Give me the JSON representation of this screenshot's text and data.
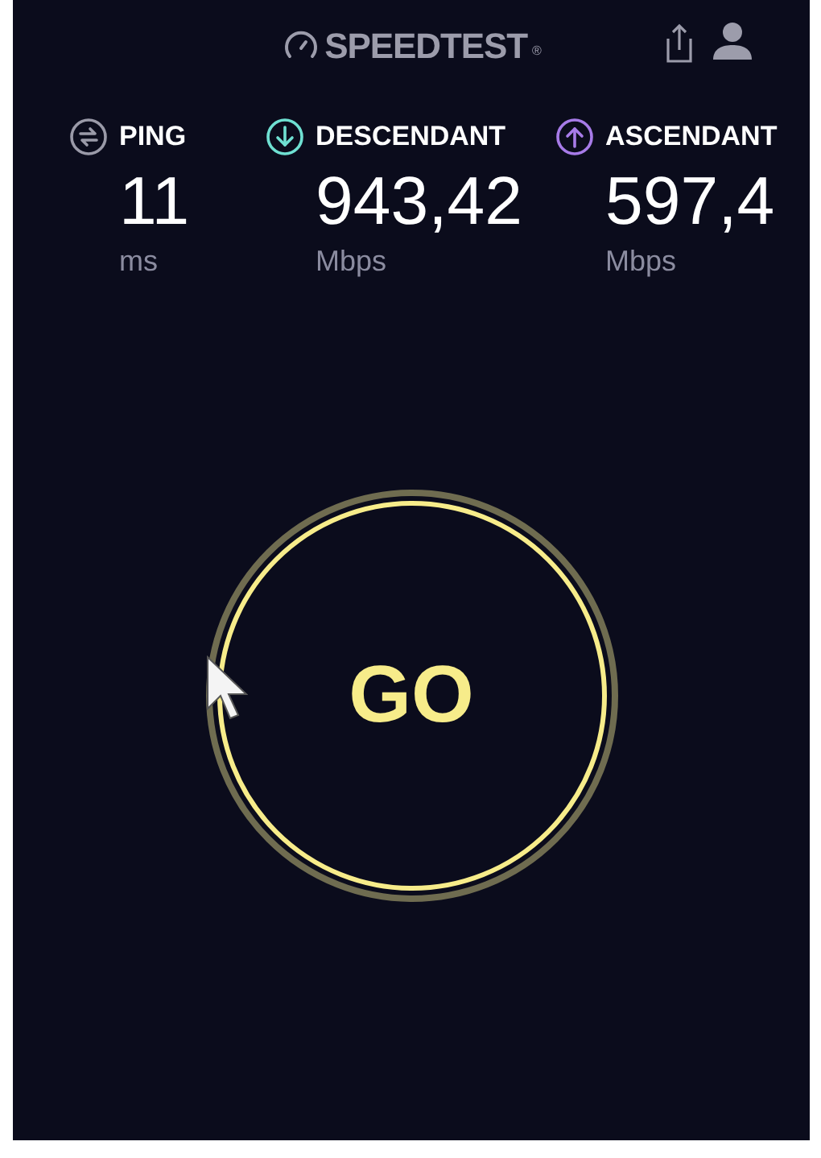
{
  "header": {
    "brand": "SPEEDTEST",
    "brand_mark": "®"
  },
  "metrics": [
    {
      "kind": "ping",
      "label": "PING",
      "value": "11",
      "unit": "ms",
      "color": "#9a9aa8"
    },
    {
      "kind": "download",
      "label": "DESCENDANT",
      "value": "943,42",
      "unit": "Mbps",
      "color": "#6fe0d2"
    },
    {
      "kind": "upload",
      "label": "ASCENDANT",
      "value": "597,4",
      "unit": "Mbps",
      "color": "#a77be8"
    }
  ],
  "start_button": {
    "label": "GO"
  }
}
